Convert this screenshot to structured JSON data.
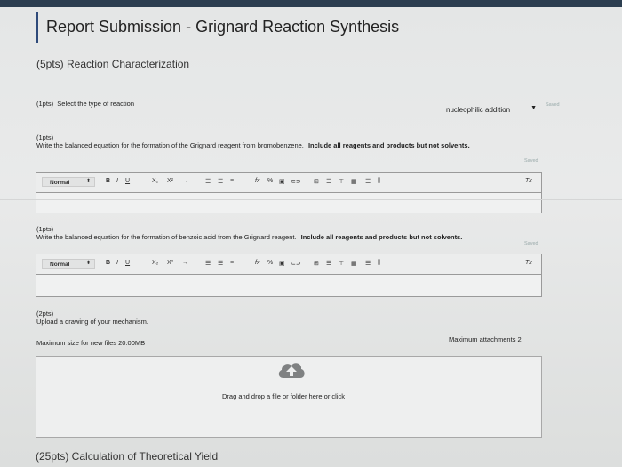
{
  "header": {
    "title": "Report Submission - Grignard Reaction Synthesis"
  },
  "section1": {
    "heading": "(5pts) Reaction Characterization"
  },
  "q1": {
    "points": "(1pts)",
    "prompt": "Select the type of reaction",
    "selected": "nucleophilic addition",
    "saved": "Saved"
  },
  "q2": {
    "points": "(1pts)",
    "prompt": "Write the balanced equation for the formation of the Grignard reagent from bromobenzene.",
    "instruction": "Include all reagents and products but not solvents.",
    "saved": "Saved"
  },
  "q3": {
    "points": "(1pts)",
    "prompt": "Write the balanced equation for the formation of benzoic acid from the Grignard reagent.",
    "instruction": "Include all reagents and products but not solvents.",
    "saved": "Saved"
  },
  "toolbar": {
    "style": "Normal",
    "bold": "B",
    "italic": "I",
    "underline": "U",
    "subscript": "X₂",
    "superscript": "X²",
    "arrow": "→",
    "clear_format": "Tx"
  },
  "q4": {
    "points": "(2pts)",
    "prompt": "Upload a drawing of your mechanism.",
    "max_size": "Maximum size for new files  20.00MB",
    "max_attachments": "Maximum attachments  2",
    "drop_text": "Drag and drop a file or folder here or click"
  },
  "section2": {
    "heading": "(25pts) Calculation of Theoretical Yield"
  }
}
